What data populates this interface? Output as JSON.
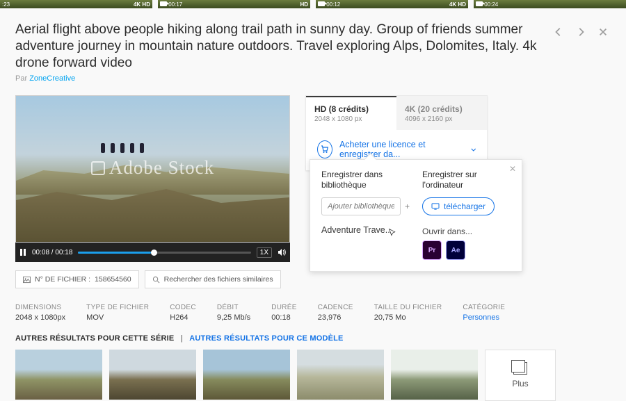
{
  "topstrip": [
    {
      "time": ":23",
      "badge": "4K  HD"
    },
    {
      "time": "00:17",
      "badge": "HD",
      "cam": true
    },
    {
      "time": "00:12",
      "badge": "4K  HD",
      "cam": true
    },
    {
      "time": "00:24",
      "badge": "",
      "cam": true
    }
  ],
  "title": "Aerial flight above people hiking along trail path in sunny day. Group of friends summer adventure journey in mountain nature outdoors. Travel exploring Alps, Dolomites, Italy. 4k drone forward video",
  "byline_prefix": "Par ",
  "author": "ZoneCreative",
  "watermark": "Adobe Stock",
  "player": {
    "time": "00:08 / 00:18",
    "speed": "1X"
  },
  "file_label": "N° DE FICHIER : ",
  "file_num": "158654560",
  "similar": "Rechercher des fichiers similaires",
  "tabs": {
    "hd": {
      "title": "HD (8 crédits)",
      "sub": "2048 x 1080 px"
    },
    "k4": {
      "title": "4K (20 crédits)",
      "sub": "4096 x 2160 px"
    }
  },
  "cta": "Acheter une licence et enregistrer da...",
  "popover": {
    "left_h": "Enregistrer dans bibliothèque",
    "placeholder": "Ajouter bibliothèque",
    "library_item": "Adventure Trave...",
    "right_h": "Enregistrer sur l'ordinateur",
    "dl": "télécharger",
    "openin": "Ouvrir dans...",
    "pr": "Pr",
    "ae": "Ae"
  },
  "specs": [
    {
      "lab": "DIMENSIONS",
      "val": "2048 x 1080px"
    },
    {
      "lab": "TYPE DE FICHIER",
      "val": "MOV"
    },
    {
      "lab": "CODEC",
      "val": "H264"
    },
    {
      "lab": "DÉBIT",
      "val": "9,25 Mb/s"
    },
    {
      "lab": "DURÉE",
      "val": "00:18"
    },
    {
      "lab": "CADENCE",
      "val": "23,976"
    },
    {
      "lab": "TAILLE DU FICHIER",
      "val": "20,75 Mo"
    },
    {
      "lab": "CATÉGORIE",
      "val": "Personnes",
      "link": true
    }
  ],
  "results_series": "AUTRES RÉSULTATS POUR CETTE SÉRIE",
  "results_model": "AUTRES RÉSULTATS POUR CE MODÈLE",
  "plus": "Plus"
}
